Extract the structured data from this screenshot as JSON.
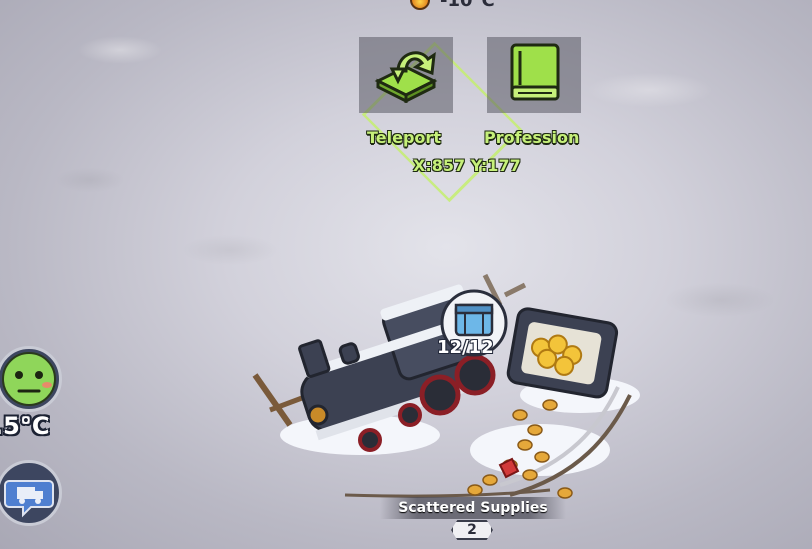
{
  "top_status": {
    "temperature_label": "-10°C"
  },
  "actions": [
    {
      "label": "Teleport",
      "icon": "teleport-icon"
    },
    {
      "label": "Profession",
      "icon": "book-icon"
    }
  ],
  "selection": {
    "coordinates": "X:857 Y:177"
  },
  "player": {
    "temperature": ".5°C",
    "status_icon": "face-cold-icon"
  },
  "chat": {
    "icon": "chat-truck-icon"
  },
  "object": {
    "name": "Scattered Supplies",
    "level": "2",
    "capacity": "12/12",
    "resource_icon": "supply-crate-icon"
  },
  "colors": {
    "accent_green": "#c6f07a",
    "panel_dark": "#3d4660"
  }
}
